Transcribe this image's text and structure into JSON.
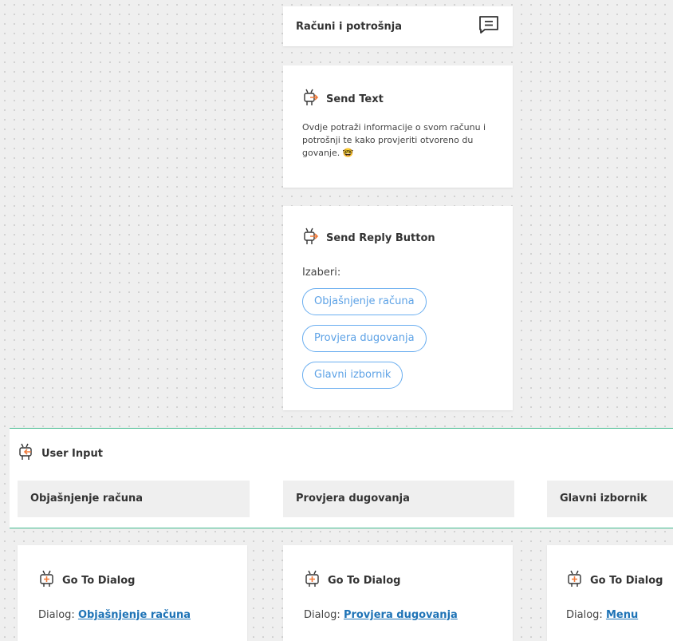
{
  "top_card": {
    "title": "Računi i potrošnja",
    "icon": "comment-icon"
  },
  "send_text": {
    "title": "Send Text",
    "body": "Ovdje potraži informacije o svom računu i potrošnji te kako provjeriti otvoreno du govanje.",
    "emoji": "🤓"
  },
  "reply": {
    "title": "Send Reply Button",
    "prompt": "Izaberi:",
    "buttons": [
      "Objašnjenje računa",
      "Provjera dugovanja",
      "Glavni izbornik"
    ]
  },
  "user_input": {
    "title": "User Input",
    "columns": [
      "Objašnjenje računa",
      "Provjera dugovanja",
      "Glavni izbornik"
    ]
  },
  "goto": [
    {
      "title": "Go To Dialog",
      "label": "Dialog:",
      "target": "Objašnjenje računa"
    },
    {
      "title": "Go To Dialog",
      "label": "Dialog:",
      "target": "Provjera dugovanja"
    },
    {
      "title": "Go To Dialog",
      "label": "Dialog:",
      "target": "Menu"
    }
  ],
  "colors": {
    "accent_link": "#1e73b6",
    "reply_border": "#6aaef0",
    "separator": "#42b98d",
    "robot_orange": "#f07a3a"
  }
}
